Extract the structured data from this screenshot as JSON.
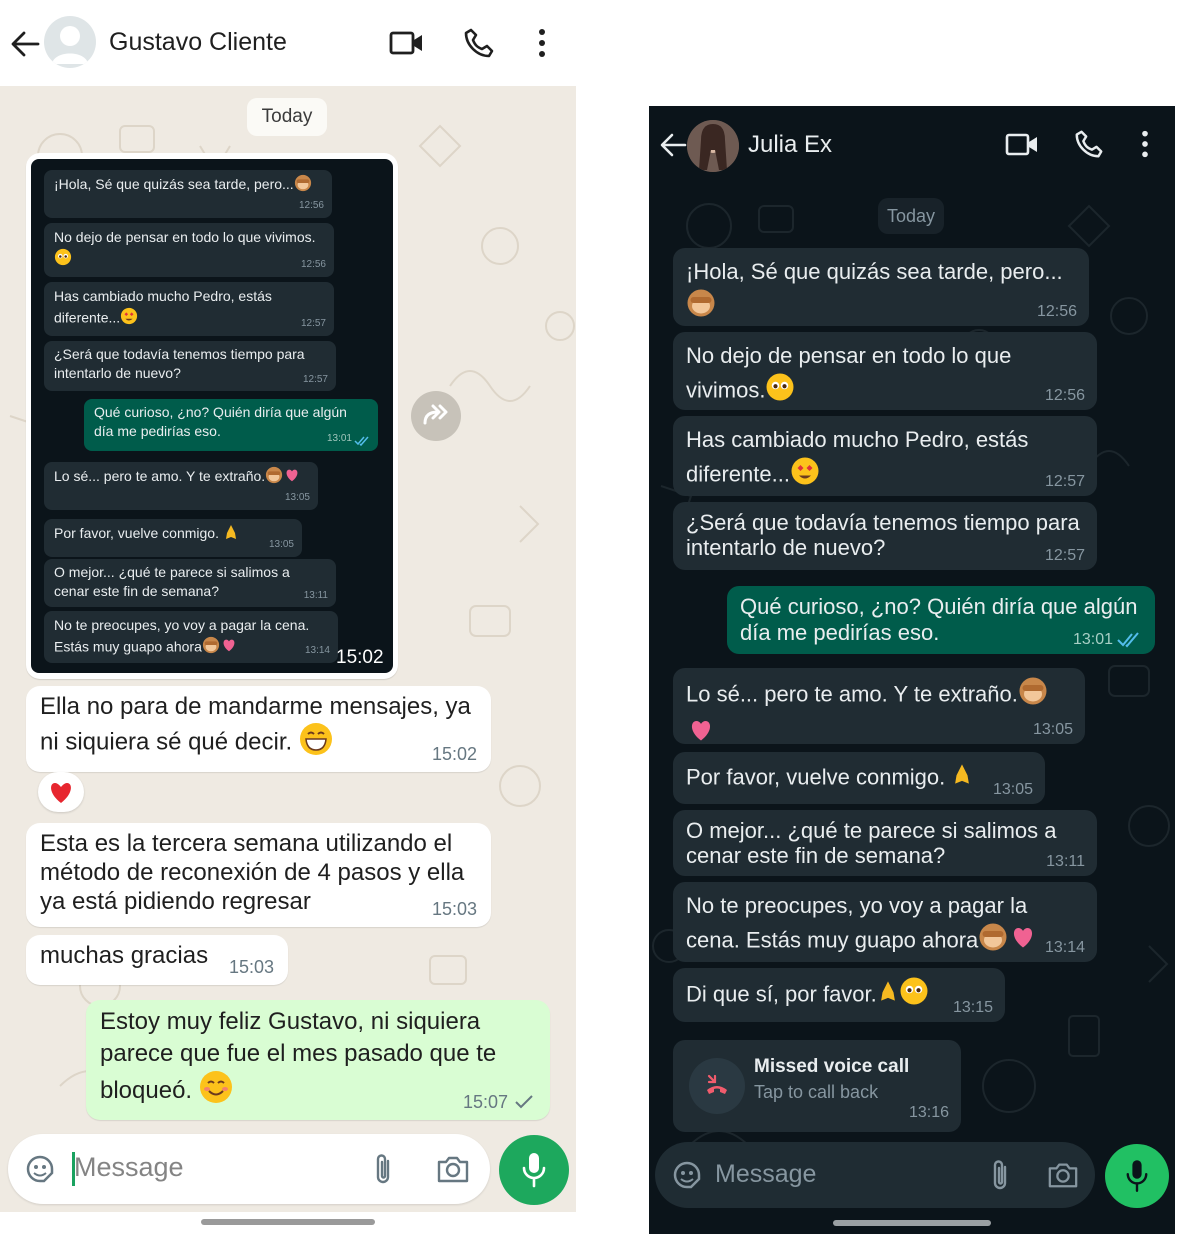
{
  "left": {
    "contact_name": "Gustavo Cliente",
    "date_pill": "Today",
    "screenshot": {
      "time": "15:02",
      "messages": [
        {
          "text": "¡Hola, Sé que quizás sea tarde, pero...",
          "time": "12:56",
          "direction": "in"
        },
        {
          "text": "No dejo de pensar en todo lo que vivimos.",
          "time": "12:56",
          "direction": "in"
        },
        {
          "text": "Has cambiado mucho Pedro, estás diferente...",
          "time": "12:57",
          "direction": "in"
        },
        {
          "text": "¿Será que todavía tenemos tiempo para intentarlo de nuevo?",
          "time": "12:57",
          "direction": "in"
        },
        {
          "text": "Qué curioso, ¿no? Quién diría que algún día me pedirías eso.",
          "time": "13:01",
          "direction": "out"
        },
        {
          "text": "Lo sé... pero te amo. Y te extraño.",
          "time": "13:05",
          "direction": "in"
        },
        {
          "text": "Por favor, vuelve conmigo.",
          "time": "13:05",
          "direction": "in"
        },
        {
          "text": "O mejor... ¿qué te parece si salimos a cenar este fin de semana?",
          "time": "13:11",
          "direction": "in"
        },
        {
          "text": "No te preocupes, yo voy a pagar la cena. Estás muy guapo ahora",
          "time": "13:14",
          "direction": "in"
        }
      ]
    },
    "messages": [
      {
        "text": "Ella no para de mandarme mensajes, ya ni siquiera sé qué decir.",
        "time": "15:02",
        "direction": "in"
      },
      {
        "text": "Esta es la tercera semana utilizando el método de reconexión de 4 pasos y ella ya está pidiendo regresar",
        "time": "15:03",
        "direction": "in"
      },
      {
        "text": "muchas gracias",
        "time": "15:03",
        "direction": "in"
      },
      {
        "text": "Estoy muy feliz Gustavo, ni siquiera parece que fue el mes pasado que te bloqueó.",
        "time": "15:07",
        "direction": "out"
      }
    ],
    "reaction": "heart",
    "input_placeholder": "Message"
  },
  "right": {
    "contact_name": "Julia Ex",
    "date_pill": "Today",
    "messages": [
      {
        "text": "¡Hola, Sé que quizás sea tarde, pero...",
        "time": "12:56",
        "direction": "in"
      },
      {
        "text": "No dejo de pensar en todo lo que vivimos.",
        "time": "12:56",
        "direction": "in"
      },
      {
        "text": "Has cambiado mucho Pedro, estás diferente...",
        "time": "12:57",
        "direction": "in"
      },
      {
        "text": "¿Será que todavía tenemos tiempo para intentarlo de nuevo?",
        "time": "12:57",
        "direction": "in"
      },
      {
        "text": "Qué curioso, ¿no? Quién diría que algún día me pedirías eso.",
        "time": "13:01",
        "direction": "out"
      },
      {
        "text": "Lo sé... pero te amo. Y te extraño.",
        "time": "13:05",
        "direction": "in"
      },
      {
        "text": "Por favor, vuelve conmigo.",
        "time": "13:05",
        "direction": "in"
      },
      {
        "text": "O mejor... ¿qué te parece si salimos a cenar este fin de semana?",
        "time": "13:11",
        "direction": "in"
      },
      {
        "text": "No te preocupes, yo voy a pagar la cena. Estás muy guapo ahora",
        "time": "13:14",
        "direction": "in"
      },
      {
        "text": "Di que sí, por favor.",
        "time": "13:15",
        "direction": "in"
      }
    ],
    "missed_call": {
      "title": "Missed voice call",
      "subtitle": "Tap to call back",
      "time": "13:16"
    },
    "input_placeholder": "Message"
  },
  "colors": {
    "wa_green": "#1da85d",
    "light_outgoing": "#d9fdd3",
    "dark_outgoing": "#005c4b",
    "dark_bubble": "#202c33",
    "read_tick": "#53bdeb",
    "missed_red": "#f15c6d"
  }
}
